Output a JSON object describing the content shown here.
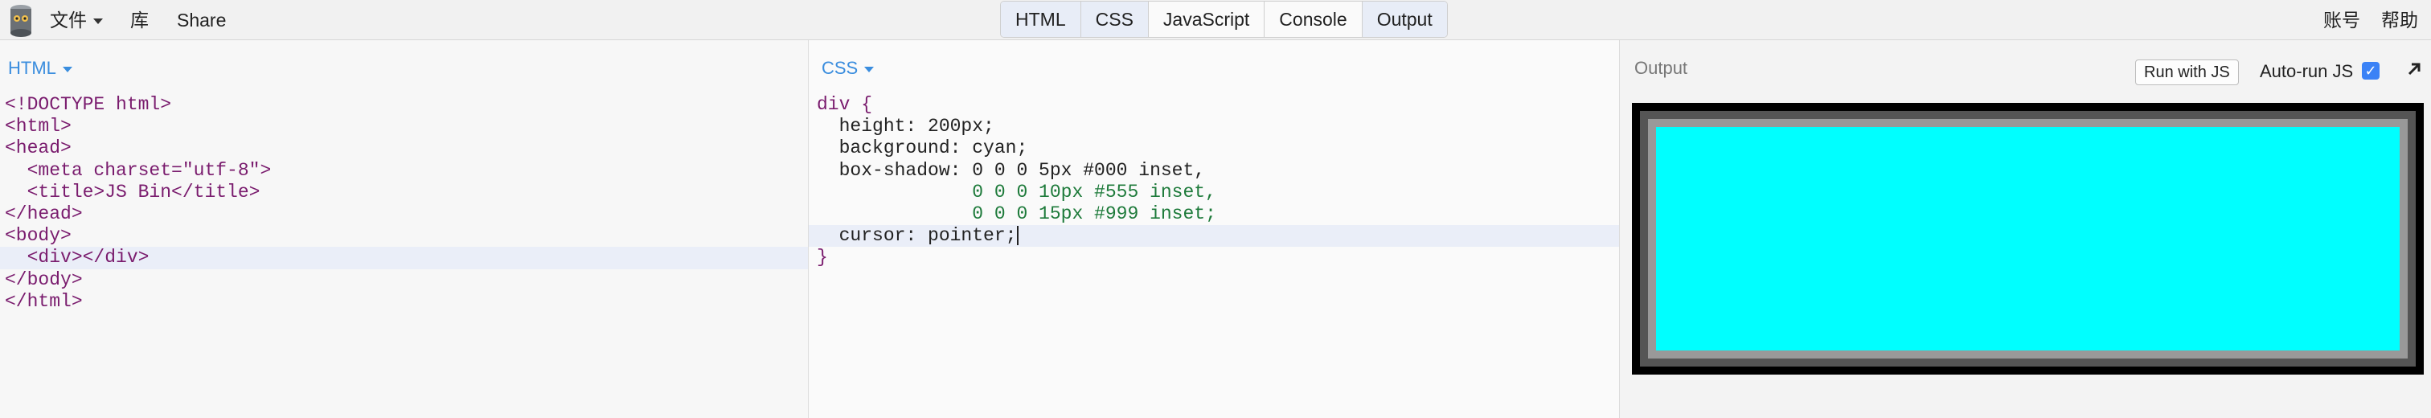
{
  "menu": {
    "file": "文件",
    "library": "库",
    "share": "Share",
    "account": "账号",
    "help": "帮助"
  },
  "panel_tabs": [
    "HTML",
    "CSS",
    "JavaScript",
    "Console",
    "Output"
  ],
  "html_panel": {
    "label": "HTML"
  },
  "css_panel": {
    "label": "CSS"
  },
  "output_panel": {
    "title": "Output",
    "run_button": "Run with JS",
    "autorun_label": "Auto-run JS",
    "autorun_checked": true,
    "preview_color": "#00ffff"
  },
  "html_code": [
    "<!DOCTYPE html>",
    "<html>",
    "<head>",
    "  <meta charset=\"utf-8\">",
    "  <title>JS Bin</title>",
    "</head>",
    "<body>",
    "  <div></div>",
    "</body>",
    "</html>"
  ],
  "css_code": [
    "div {",
    "  height: 200px;",
    "  background: cyan;",
    "  box-shadow: 0 0 0 5px #000 inset,",
    "              0 0 0 10px #555 inset,",
    "              0 0 0 15px #999 inset;",
    "  cursor: pointer;",
    "}"
  ],
  "colors": {
    "accent": "#3a8dde",
    "checkbox": "#3b82f6",
    "line_highlight": "#eaeef8"
  }
}
